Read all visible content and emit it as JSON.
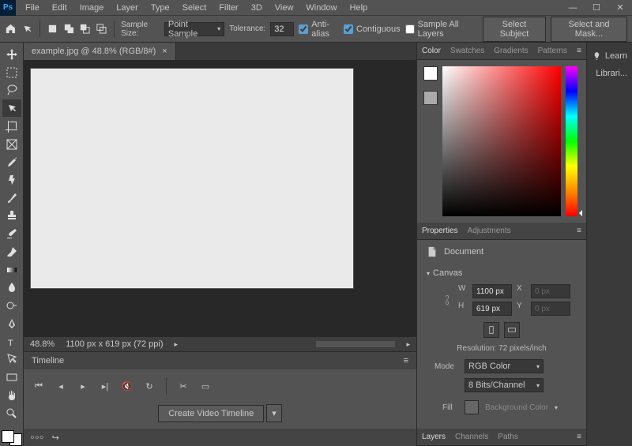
{
  "menu": [
    "File",
    "Edit",
    "Image",
    "Layer",
    "Type",
    "Select",
    "Filter",
    "3D",
    "View",
    "Window",
    "Help"
  ],
  "options": {
    "sample_size_label": "Sample Size:",
    "sample_size_value": "Point Sample",
    "tolerance_label": "Tolerance:",
    "tolerance_value": "32",
    "antialias": "Anti-alias",
    "contiguous": "Contiguous",
    "sample_all": "Sample All Layers",
    "select_subject": "Select Subject",
    "select_and_mask": "Select and Mask..."
  },
  "tab": {
    "title": "example.jpg @ 48.8% (RGB/8#)"
  },
  "status": {
    "zoom": "48.8%",
    "dims": "1100 px x 619 px (72 ppi)"
  },
  "timeline": {
    "title": "Timeline",
    "action": "Create Video Timeline"
  },
  "color_tabs": [
    "Color",
    "Swatches",
    "Gradients",
    "Patterns"
  ],
  "props_tabs": [
    "Properties",
    "Adjustments"
  ],
  "props": {
    "doc": "Document",
    "canvas": "Canvas",
    "w_label": "W",
    "w_value": "1100 px",
    "h_label": "H",
    "h_value": "619 px",
    "x_label": "X",
    "x_value": "0 px",
    "y_label": "Y",
    "y_value": "0 px",
    "resolution": "Resolution: 72 pixels/inch",
    "mode_label": "Mode",
    "mode_value": "RGB Color",
    "bits": "8 Bits/Channel",
    "fill_label": "Fill",
    "fill_value": "Background Color"
  },
  "layers_tabs": [
    "Layers",
    "Channels",
    "Paths"
  ],
  "far_right": {
    "learn": "Learn",
    "libraries": "Librari..."
  }
}
